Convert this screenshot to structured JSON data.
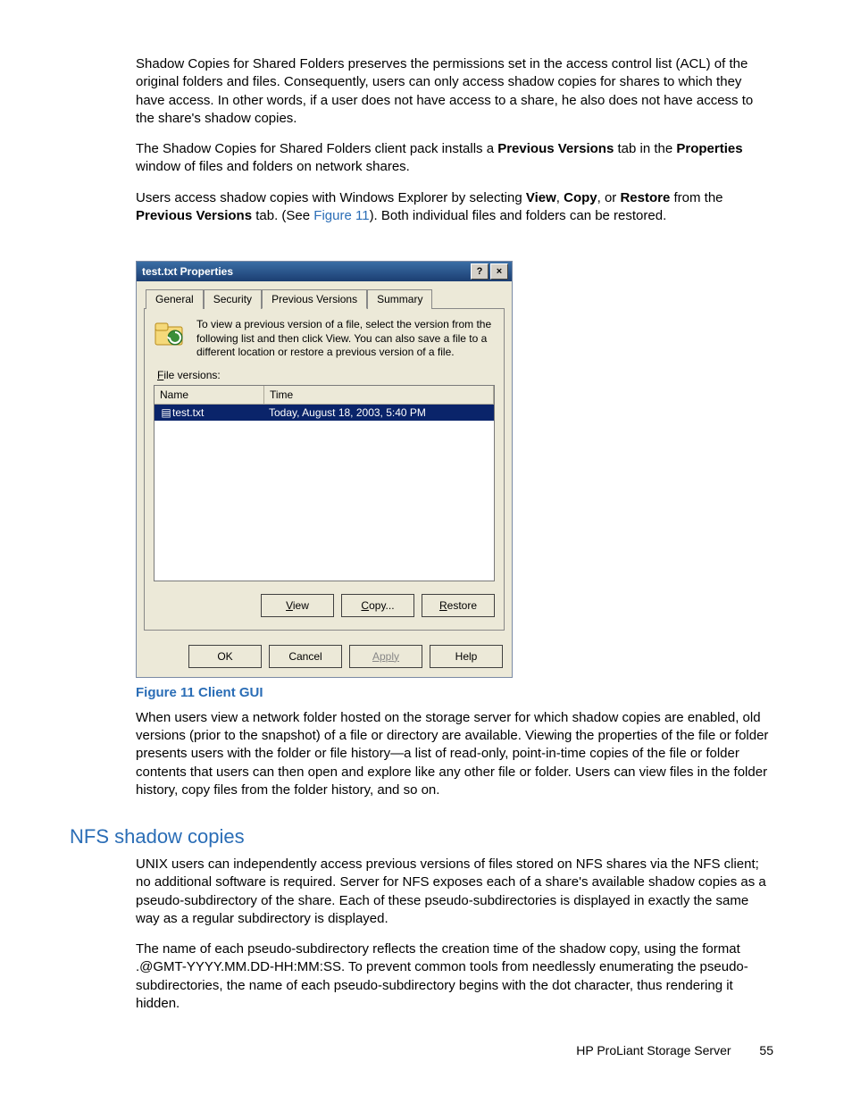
{
  "body": {
    "p1": "Shadow Copies for Shared Folders preserves the permissions set in the access control list (ACL) of the original folders and files. Consequently, users can only access shadow copies for shares to which they have access. In other words, if a user does not have access to a share, he also does not have access to the share's shadow copies.",
    "p2a": "The Shadow Copies for Shared Folders client pack installs a ",
    "p2b": "Previous Versions",
    "p2c": " tab in the ",
    "p2d": "Properties",
    "p2e": " window of files and folders on network shares.",
    "p3a": "Users access shadow copies with Windows Explorer by selecting ",
    "p3_view": "View",
    "p3_sep1": ", ",
    "p3_copy": "Copy",
    "p3_sep2": ", or ",
    "p3_restore": "Restore",
    "p3b": " from the ",
    "p3c": "Previous Versions",
    "p3d": " tab. (See ",
    "p3_link": "Figure 11",
    "p3e": "). Both individual files and folders can be restored.",
    "figcaption": "Figure 11 Client GUI",
    "p4": "When users view a network folder hosted on the storage server for which shadow copies are enabled, old versions (prior to the snapshot) of a file or directory are available. Viewing the properties of the file or folder presents users with the folder or file history—a list of read-only, point-in-time copies of the file or folder contents that users can then open and explore like any other file or folder. Users can view files in the folder history, copy files from the folder history, and so on."
  },
  "section2": {
    "heading": "NFS shadow copies",
    "p1": "UNIX users can independently access previous versions of files stored on NFS shares via the NFS client; no additional software is required. Server for NFS exposes each of a share's available shadow copies as a pseudo-subdirectory of the share. Each of these pseudo-subdirectories is displayed in exactly the same way as a regular subdirectory is displayed.",
    "p2": "The name of each pseudo-subdirectory reflects the creation time of the shadow copy, using the format .@GMT-YYYY.MM.DD-HH:MM:SS. To prevent common tools from needlessly enumerating the pseudo-subdirectories, the name of each pseudo-subdirectory begins with the dot character, thus rendering it hidden."
  },
  "footer": {
    "label": "HP ProLiant Storage Server",
    "page": "55"
  },
  "dialog": {
    "title": "test.txt Properties",
    "help_glyph": "?",
    "close_glyph": "×",
    "tabs": {
      "general": "General",
      "security": "Security",
      "prev": "Previous Versions",
      "summary": "Summary"
    },
    "description": "To view a previous version of a file, select the version from the following list and then click View.  You can also save a file to a different location or restore a previous version of a file.",
    "file_versions_label_pre": "F",
    "file_versions_label": "ile versions:",
    "columns": {
      "name": "Name",
      "time": "Time"
    },
    "row": {
      "icon": "▤",
      "name": "test.txt",
      "time": "Today, August 18, 2003, 5:40 PM"
    },
    "buttons": {
      "view_u": "V",
      "view": "iew",
      "copy_u": "C",
      "copy": "opy...",
      "restore_u": "R",
      "restore": "estore",
      "ok": "OK",
      "cancel": "Cancel",
      "apply": "Apply",
      "help": "Help"
    }
  }
}
